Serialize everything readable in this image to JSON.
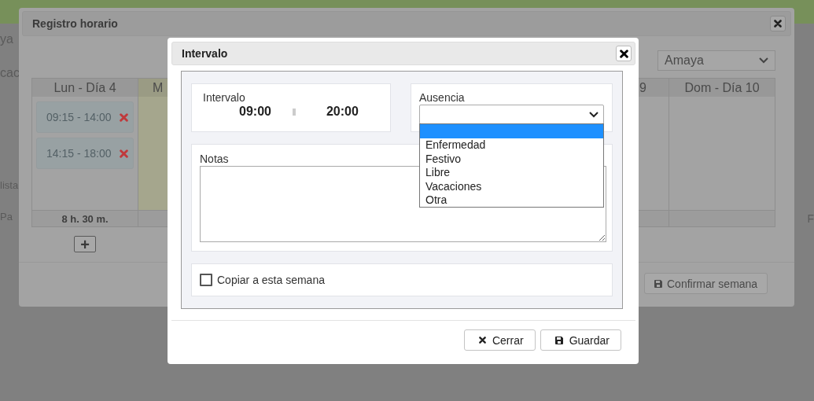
{
  "page": {
    "edge_texts": [
      "ya",
      "cac",
      "lista",
      "Pa"
    ],
    "right_edge_text": "F"
  },
  "back_dialog": {
    "title": "Registro horario",
    "employee_select": "Amaya",
    "days": [
      {
        "label": "Lun - Día 4",
        "highlighted": false,
        "intervals": [
          "09:15 - 14:00",
          "14:15 - 18:00"
        ],
        "total": "8 h. 30 m."
      },
      {
        "label": "M",
        "highlighted": true
      },
      {
        "label": "9",
        "highlighted": false
      },
      {
        "label": "Dom - Día 10",
        "highlighted": false
      }
    ],
    "add_button": "+",
    "confirm_button": "Confirmar semana"
  },
  "modal": {
    "title": "Intervalo",
    "interval": {
      "label": "Intervalo",
      "start": "09:00",
      "end": "20:00"
    },
    "absence": {
      "label": "Ausencia",
      "expanded": true,
      "options": [
        {
          "selected": true
        },
        {
          "label": "Enfermedad",
          "selected": false
        },
        {
          "label": "Festivo",
          "selected": false
        },
        {
          "label": "Libre",
          "selected": false
        },
        {
          "label": "Vacaciones",
          "selected": false
        },
        {
          "label": "Otra",
          "selected": false
        }
      ]
    },
    "notes": {
      "label": "Notas"
    },
    "copy_week": {
      "label": "Copiar a esta semana",
      "checked": false
    },
    "buttons": [
      {
        "kind": "close",
        "label": "Cerrar"
      },
      {
        "kind": "save",
        "label": "Guardar"
      }
    ]
  }
}
